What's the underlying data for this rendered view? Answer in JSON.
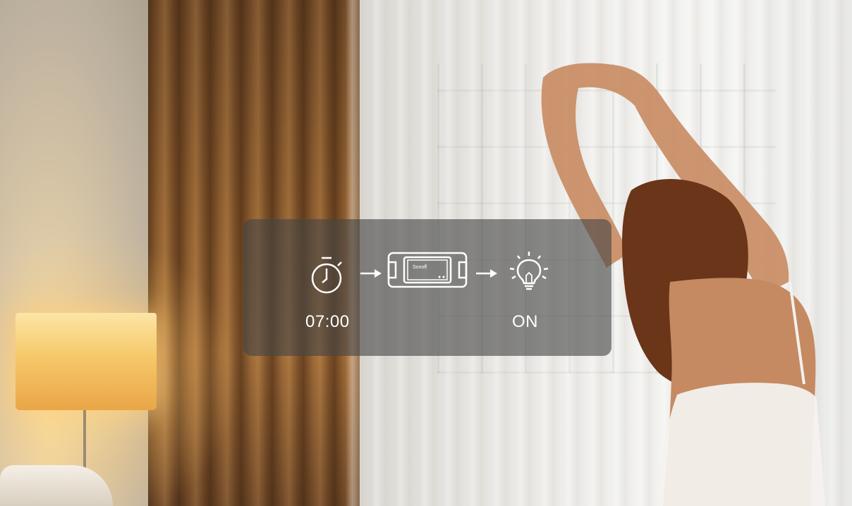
{
  "overlay": {
    "time": "07:00",
    "state": "ON"
  },
  "device": {
    "brand": "Sonoff"
  },
  "icons": [
    "stopwatch-icon",
    "right-arrow-icon",
    "smart-switch-icon",
    "right-arrow-icon",
    "light-bulb-icon"
  ]
}
